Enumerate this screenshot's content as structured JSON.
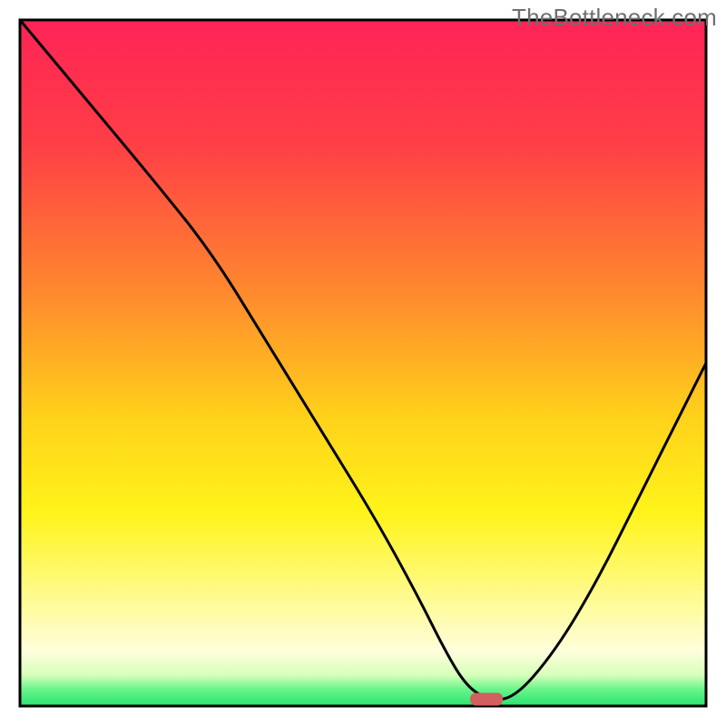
{
  "watermark": "TheBottleneck.com",
  "chart_data": {
    "type": "line",
    "title": "",
    "xlabel": "",
    "ylabel": "",
    "xlim": [
      0,
      100
    ],
    "ylim": [
      0,
      100
    ],
    "background": {
      "type": "vertical-gradient",
      "stops": [
        {
          "offset": 0.0,
          "color": "#ff2457"
        },
        {
          "offset": 0.18,
          "color": "#ff3e46"
        },
        {
          "offset": 0.4,
          "color": "#ff8a2e"
        },
        {
          "offset": 0.58,
          "color": "#ffd21a"
        },
        {
          "offset": 0.72,
          "color": "#fff41a"
        },
        {
          "offset": 0.84,
          "color": "#fffb8e"
        },
        {
          "offset": 0.92,
          "color": "#fffedc"
        },
        {
          "offset": 0.955,
          "color": "#d7ffba"
        },
        {
          "offset": 0.975,
          "color": "#6bf58b"
        },
        {
          "offset": 1.0,
          "color": "#29e36f"
        }
      ]
    },
    "series": [
      {
        "name": "bottleneck-curve",
        "color": "#000000",
        "x": [
          0,
          10,
          20,
          28,
          36,
          44,
          52,
          58,
          62,
          65,
          68,
          72,
          78,
          84,
          90,
          96,
          100
        ],
        "values": [
          100,
          88,
          76,
          66,
          53,
          40,
          27,
          16,
          8,
          3,
          1,
          1,
          8,
          18,
          30,
          42,
          50
        ]
      }
    ],
    "marker": {
      "name": "optimum-marker",
      "x": 68,
      "y": 1,
      "color": "#d1605e",
      "rx": 18,
      "ry": 7
    }
  }
}
